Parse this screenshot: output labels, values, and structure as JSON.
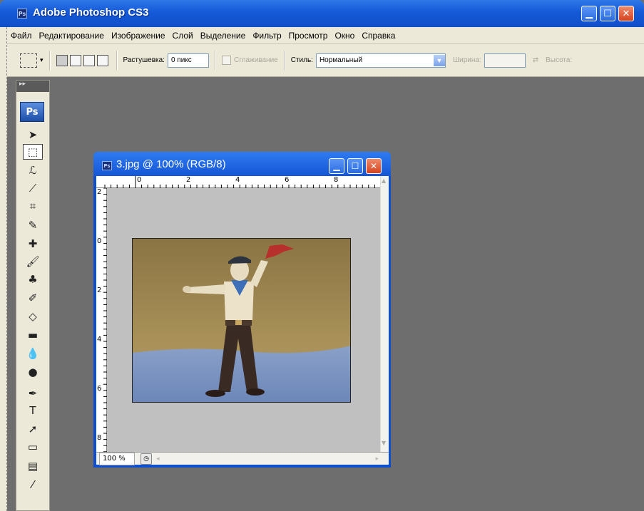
{
  "window": {
    "title": "Adobe Photoshop CS3",
    "icon_text": "Ps",
    "icon": "photoshop-icon"
  },
  "menubar": {
    "items": [
      "Файл",
      "Редактирование",
      "Изображение",
      "Слой",
      "Выделение",
      "Фильтр",
      "Просмотр",
      "Окно",
      "Справка"
    ]
  },
  "options": {
    "feather_label": "Растушевка:",
    "feather_value": "0 пикс",
    "antialias_label": "Сглаживание",
    "style_label": "Стиль:",
    "style_value": "Нормальный",
    "width_label": "Ширина:",
    "height_label": "Высота:"
  },
  "tools": {
    "logo_text": "Ps",
    "items": [
      {
        "name": "move-tool-icon",
        "glyph": "➤"
      },
      {
        "name": "marquee-tool-icon",
        "glyph": "⬚"
      },
      {
        "name": "lasso-tool-icon",
        "glyph": "ℒ"
      },
      {
        "name": "magic-wand-tool-icon",
        "glyph": "⟋"
      },
      {
        "name": "crop-tool-icon",
        "glyph": "⌗"
      },
      {
        "name": "slice-tool-icon",
        "glyph": "✎"
      },
      {
        "name": "healing-brush-tool-icon",
        "glyph": "✚"
      },
      {
        "name": "brush-tool-icon",
        "glyph": "🖌"
      },
      {
        "name": "clone-stamp-tool-icon",
        "glyph": "♣"
      },
      {
        "name": "history-brush-tool-icon",
        "glyph": "✐"
      },
      {
        "name": "eraser-tool-icon",
        "glyph": "◇"
      },
      {
        "name": "gradient-tool-icon",
        "glyph": "▬"
      },
      {
        "name": "blur-tool-icon",
        "glyph": "💧"
      },
      {
        "name": "dodge-tool-icon",
        "glyph": "●"
      },
      {
        "name": "pen-tool-icon",
        "glyph": "✒"
      },
      {
        "name": "type-tool-icon",
        "glyph": "T"
      },
      {
        "name": "path-selection-tool-icon",
        "glyph": "➚"
      },
      {
        "name": "rectangle-tool-icon",
        "glyph": "▭"
      },
      {
        "name": "notes-tool-icon",
        "glyph": "▤"
      },
      {
        "name": "eyedropper-tool-icon",
        "glyph": "⁄"
      }
    ]
  },
  "document": {
    "title": "3.jpg @ 100% (RGB/8)",
    "icon_text": "Ps",
    "zoom": "100 %",
    "ruler_top": [
      "0",
      "2",
      "4",
      "6",
      "8"
    ],
    "ruler_left": [
      "2",
      "0",
      "2",
      "4",
      "6",
      "8"
    ]
  }
}
